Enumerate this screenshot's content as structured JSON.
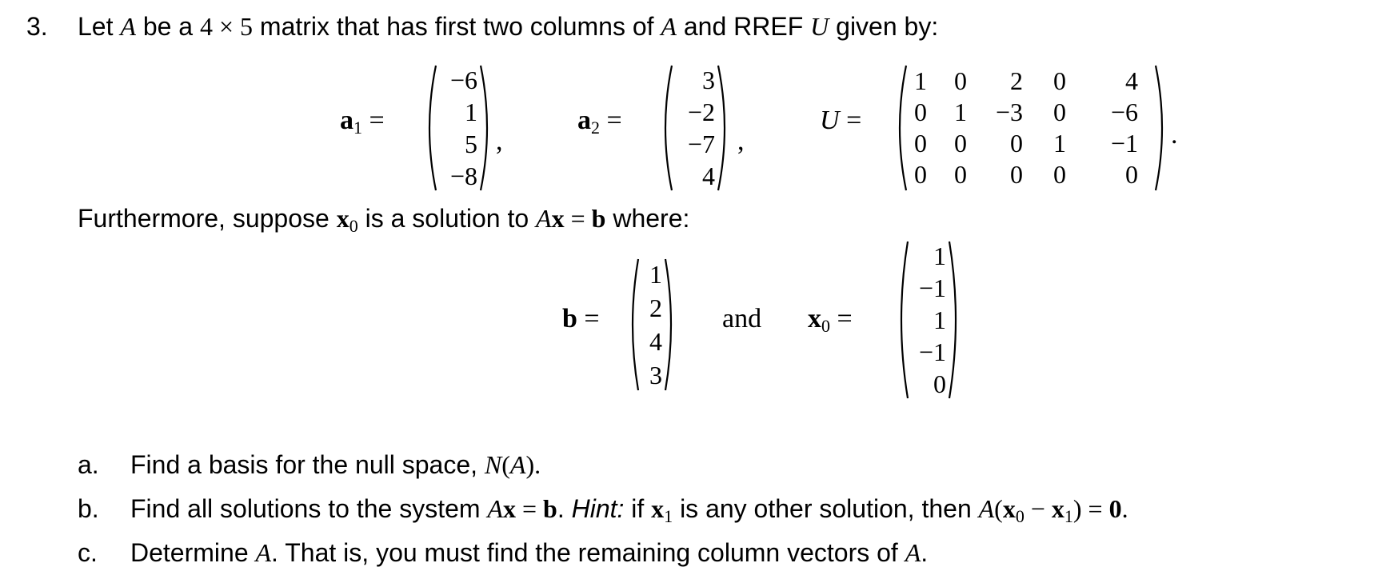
{
  "problem": {
    "number": "3.",
    "intro_parts": [
      "Let ",
      "A",
      " be a ",
      "4 × 5",
      " matrix that has first two columns of ",
      "A",
      " and RREF ",
      "U",
      " given by:"
    ],
    "a1": {
      "name": "a",
      "sub": "1",
      "values": [
        "−6",
        "1",
        "5",
        "−8"
      ]
    },
    "a2": {
      "name": "a",
      "sub": "2",
      "values": [
        "3",
        "−2",
        "−7",
        "4"
      ]
    },
    "U": {
      "name": "U",
      "rows": [
        [
          "1",
          "0",
          "2",
          "0",
          "4"
        ],
        [
          "0",
          "1",
          "−3",
          "0",
          "−6"
        ],
        [
          "0",
          "0",
          "0",
          "1",
          "−1"
        ],
        [
          "0",
          "0",
          "0",
          "0",
          "0"
        ]
      ]
    },
    "furthermore_parts": [
      "Furthermore, suppose ",
      "x",
      "0",
      " is a solution to ",
      "A",
      "x",
      " = ",
      "b",
      " where:"
    ],
    "b": {
      "name": "b",
      "values": [
        "1",
        "2",
        "4",
        "3"
      ]
    },
    "and_label": "and",
    "x0": {
      "name": "x",
      "sub": "0",
      "values": [
        "1",
        "−1",
        "1",
        "−1",
        "0"
      ]
    },
    "parts": [
      {
        "label": "a.",
        "text_parts": [
          "Find a basis for the null space, ",
          "N",
          "(",
          "A",
          ")."
        ]
      },
      {
        "label": "b.",
        "text_parts": [
          "Find all solutions to the system ",
          "A",
          "x",
          " = ",
          "b",
          ". ",
          "Hint:",
          " if ",
          "x",
          "1",
          " is any other solution, then ",
          "A",
          "(",
          "x",
          "0",
          " − ",
          "x",
          "1",
          ") = ",
          "0",
          "."
        ]
      },
      {
        "label": "c.",
        "text_parts": [
          "Determine ",
          "A",
          ". That is, you must find the remaining column vectors of ",
          "A",
          "."
        ]
      }
    ]
  }
}
